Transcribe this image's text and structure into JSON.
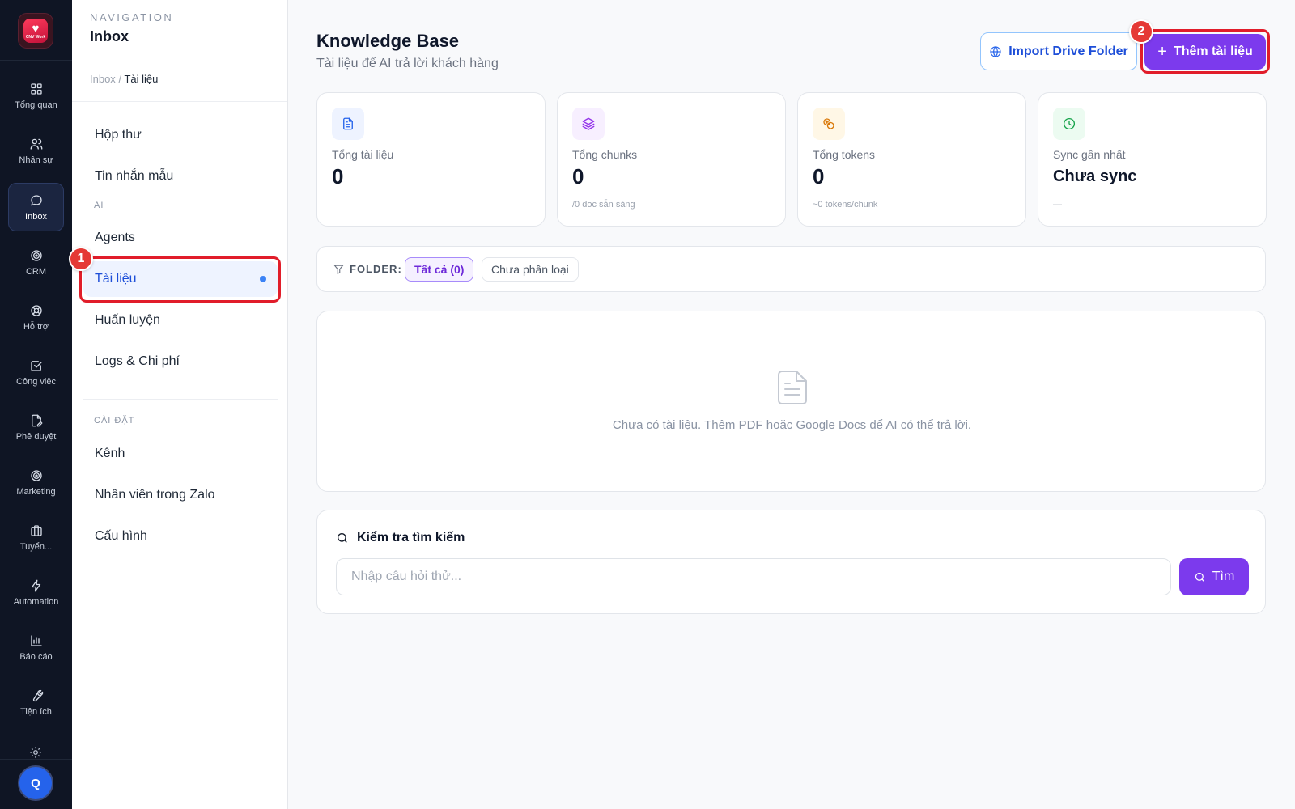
{
  "rail": {
    "logo_text": "CNV Work",
    "items": [
      {
        "label": "Tổng quan",
        "icon": "grid-icon"
      },
      {
        "label": "Nhân sự",
        "icon": "users-icon"
      },
      {
        "label": "Inbox",
        "icon": "chat-icon"
      },
      {
        "label": "CRM",
        "icon": "target-icon"
      },
      {
        "label": "Hỗ trợ",
        "icon": "lifebuoy-icon"
      },
      {
        "label": "Công việc",
        "icon": "check-square-icon"
      },
      {
        "label": "Phê duyệt",
        "icon": "file-sign-icon"
      },
      {
        "label": "Marketing",
        "icon": "target-icon"
      },
      {
        "label": "Tuyển...",
        "icon": "briefcase-icon"
      },
      {
        "label": "Automation",
        "icon": "bolt-icon"
      },
      {
        "label": "Báo cáo",
        "icon": "bar-chart-icon"
      },
      {
        "label": "Tiện ích",
        "icon": "wrench-icon"
      }
    ],
    "active": "Inbox",
    "avatar_initial": "Q"
  },
  "subnav": {
    "caption": "NAVIGATION",
    "title": "Inbox",
    "breadcrumb": {
      "parent": "Inbox",
      "separator": "/",
      "current": "Tài liệu"
    },
    "items": {
      "hop_thu": "Hộp thư",
      "tin_nhan_mau": "Tin nhắn mẫu",
      "section_ai": "AI",
      "agents": "Agents",
      "tai_lieu": "Tài liệu",
      "huan_luyen": "Huấn luyện",
      "logs": "Logs & Chi phí",
      "section_settings": "CÀI ĐẶT",
      "kenh": "Kênh",
      "nhan_vien_zalo": "Nhân viên trong Zalo",
      "cau_hinh": "Cấu hình"
    },
    "active": "Tài liệu"
  },
  "annotations": {
    "step1": "1",
    "step2": "2",
    "color": "#e11d2a"
  },
  "header": {
    "title": "Knowledge Base",
    "subtitle": "Tài liệu để AI trả lời khách hàng",
    "import_label": "Import Drive Folder",
    "add_label": "Thêm tài liệu"
  },
  "stats": [
    {
      "label": "Tổng tài liệu",
      "value": "0",
      "note": "",
      "icon": "document-icon",
      "color": "#2563eb"
    },
    {
      "label": "Tổng chunks",
      "value": "0",
      "note": "/0 doc sẵn sàng",
      "icon": "layers-icon",
      "color": "#9333ea"
    },
    {
      "label": "Tổng tokens",
      "value": "0",
      "note": "~0 tokens/chunk",
      "icon": "coins-icon",
      "color": "#d97706"
    },
    {
      "label": "Sync gần nhất",
      "value": "Chưa sync",
      "note": "—",
      "icon": "clock-icon",
      "color": "#16a34a"
    }
  ],
  "folder": {
    "caption": "FOLDER:",
    "chips": [
      "Tất cả (0)",
      "Chưa phân loại"
    ],
    "selected": "Tất cả (0)"
  },
  "empty_state": {
    "message": "Chưa có tài liệu. Thêm PDF hoặc Google Docs để AI có thể trả lời."
  },
  "search_test": {
    "title": "Kiểm tra tìm kiếm",
    "placeholder": "Nhập câu hỏi thử...",
    "value": "",
    "button_label": "Tìm"
  },
  "colors": {
    "rail_bg": "#0f1524",
    "accent_purple": "#7c3aed",
    "accent_blue": "#2563eb"
  }
}
